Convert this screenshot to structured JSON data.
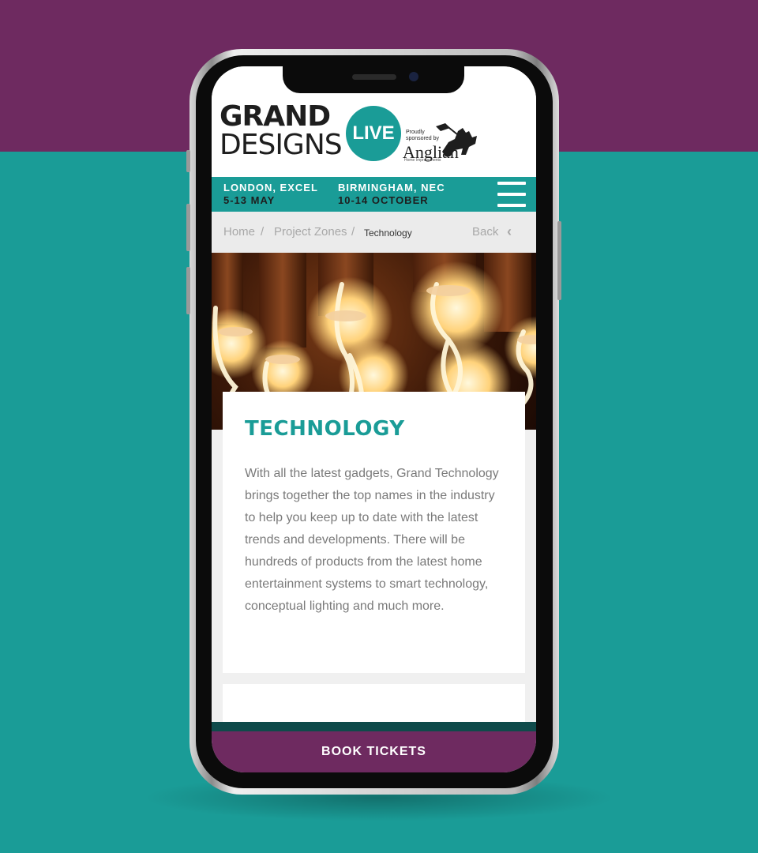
{
  "header": {
    "logo_line1": "GRAND",
    "logo_line2": "DESIGNS",
    "live_badge": "LIVE",
    "sponsor_prefix": "Proudly sponsored by",
    "sponsor_name": "Anglian",
    "sponsor_sub": "Home Improvements"
  },
  "events": [
    {
      "city": "LONDON, EXCEL",
      "dates": "5-13 MAY"
    },
    {
      "city": "BIRMINGHAM, NEC",
      "dates": "10-14 OCTOBER"
    }
  ],
  "menu_icon": "hamburger-menu-icon",
  "breadcrumb": {
    "items": [
      "Home",
      "Project Zones",
      "Technology"
    ],
    "separator": "/",
    "back_label": "Back",
    "back_icon": "chevron-left-icon"
  },
  "content": {
    "title": "TECHNOLOGY",
    "body": "With all the latest gadgets, Grand Technology brings together the top names in the industry to help you keep up to date with the latest trends and developments. There will be hundreds of products from the latest home entertainment systems to smart technology, conceptual lighting and much more."
  },
  "cta": {
    "label": "BOOK TICKETS"
  },
  "colors": {
    "teal": "#1a9c97",
    "purple": "#6e2a60",
    "text_gray": "#7a7a7a"
  }
}
